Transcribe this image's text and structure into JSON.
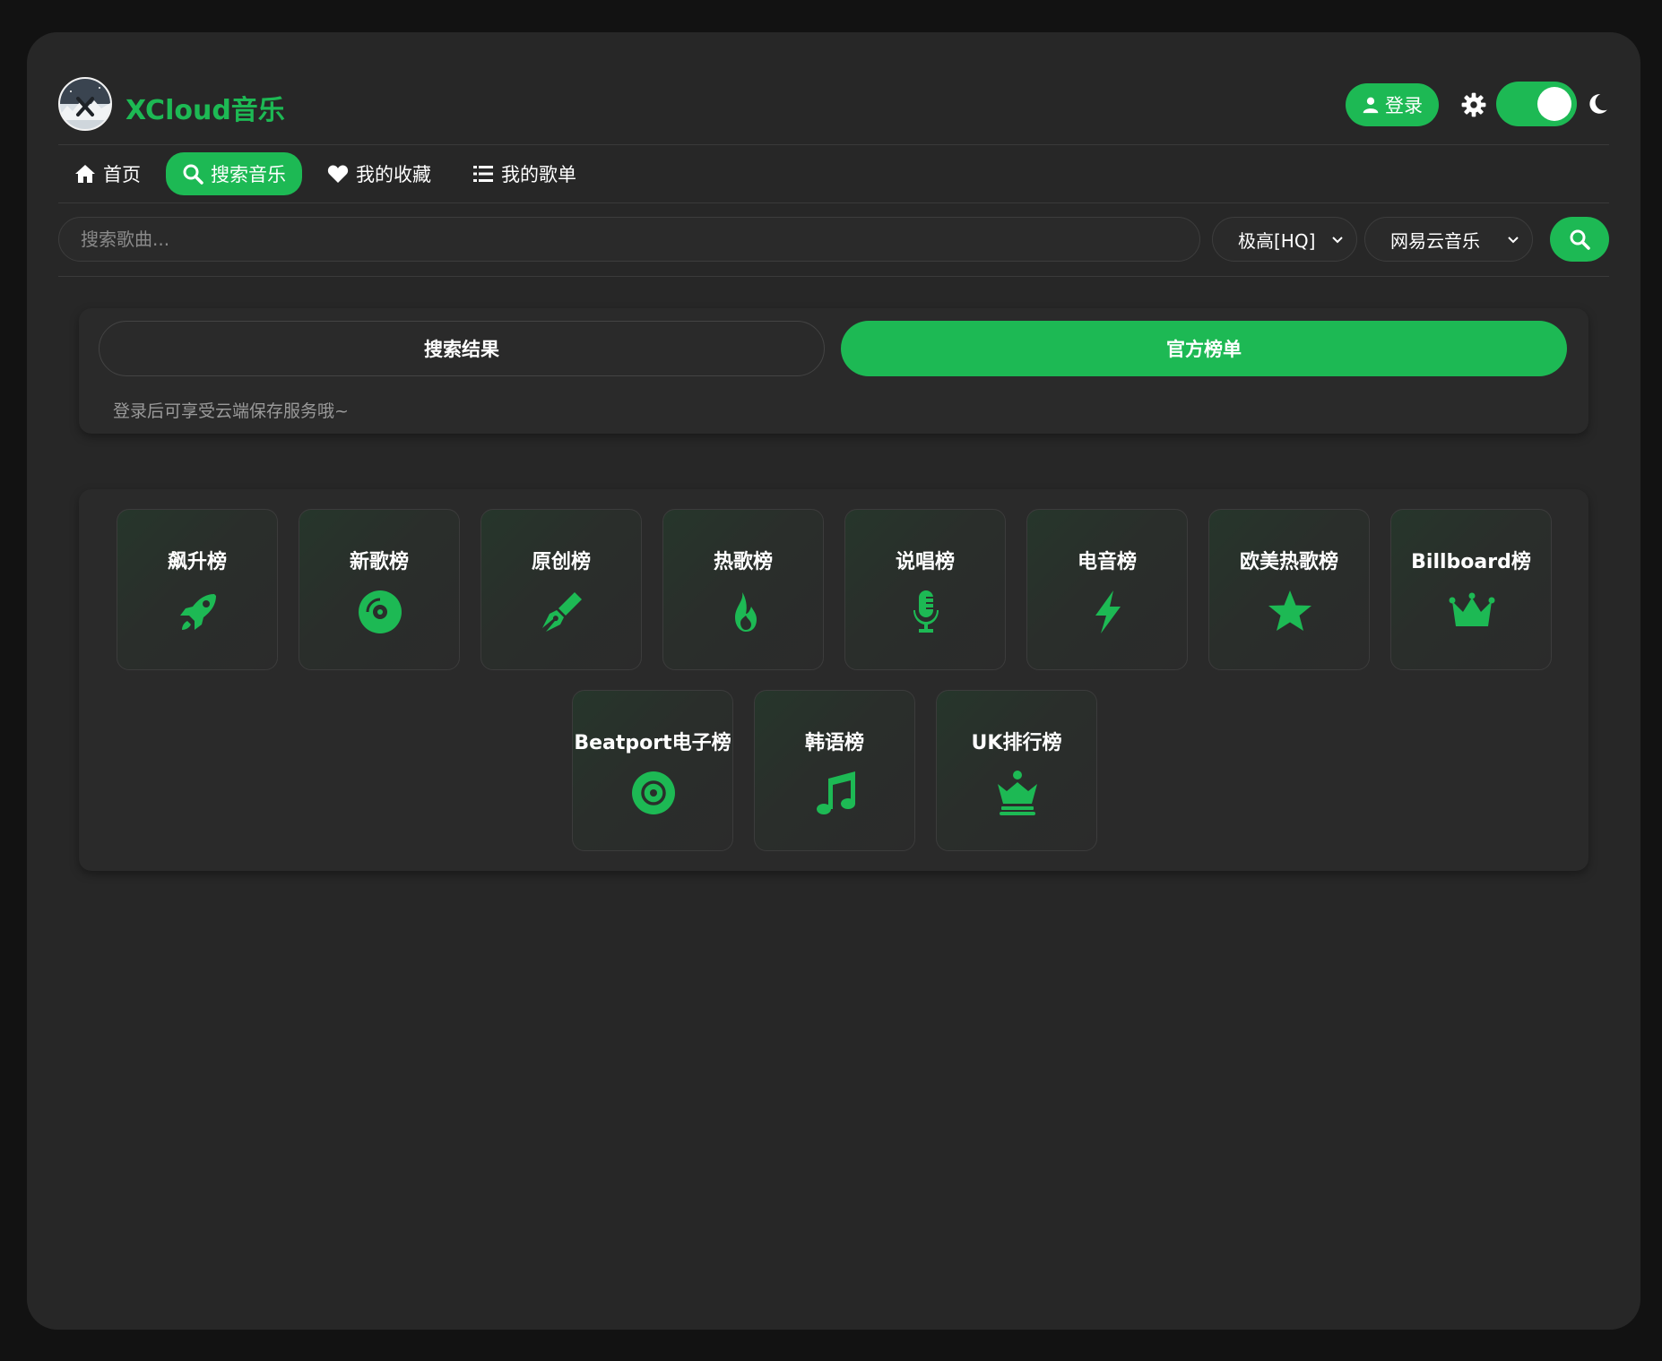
{
  "app": {
    "title": "XCloud音乐",
    "accent_color": "#1db954",
    "background_color": "#272727"
  },
  "header": {
    "login_label": "登录",
    "settings_icon": "gear-icon",
    "theme_toggle_on": true,
    "theme_icon": "moon-icon"
  },
  "nav": {
    "items": [
      {
        "label": "首页",
        "icon": "home-icon",
        "active": false
      },
      {
        "label": "搜索音乐",
        "icon": "search-icon",
        "active": true
      },
      {
        "label": "我的收藏",
        "icon": "heart-icon",
        "active": false
      },
      {
        "label": "我的歌单",
        "icon": "list-icon",
        "active": false
      }
    ]
  },
  "search": {
    "placeholder": "搜索歌曲...",
    "value": "",
    "quality": "极高[HQ]",
    "source": "网易云音乐"
  },
  "tabs": {
    "search_results": "搜索结果",
    "official_charts": "官方榜单",
    "active": "official_charts",
    "tip": "登录后可享受云端保存服务哦~"
  },
  "charts": [
    {
      "label": "飙升榜",
      "icon": "rocket-icon"
    },
    {
      "label": "新歌榜",
      "icon": "compact-disc-icon"
    },
    {
      "label": "原创榜",
      "icon": "pen-nib-icon"
    },
    {
      "label": "热歌榜",
      "icon": "fire-icon"
    },
    {
      "label": "说唱榜",
      "icon": "microphone-icon"
    },
    {
      "label": "电音榜",
      "icon": "bolt-icon"
    },
    {
      "label": "欧美热歌榜",
      "icon": "star-icon"
    },
    {
      "label": "Billboard榜",
      "icon": "crown-icon"
    },
    {
      "label": "Beatport电子榜",
      "icon": "record-icon"
    },
    {
      "label": "韩语榜",
      "icon": "music-note-icon"
    },
    {
      "label": "UK排行榜",
      "icon": "chess-queen-icon"
    }
  ]
}
